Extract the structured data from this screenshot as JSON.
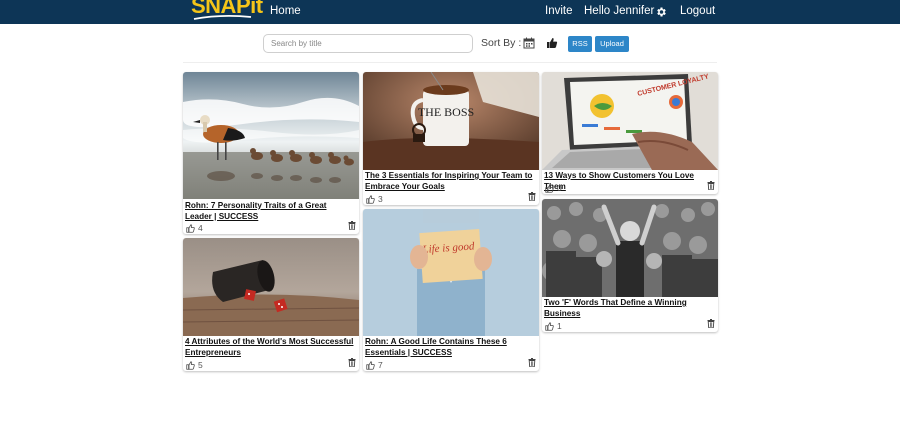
{
  "navbar": {
    "logo": "SNAPit",
    "home": "Home",
    "invite": "Invite",
    "greeting": "Hello Jennifer",
    "settings_icon": "gear-icon",
    "logout": "Logout",
    "background": "#0d3556",
    "logo_color": "#f5c518"
  },
  "toolbar": {
    "search_placeholder": "Search by title",
    "sort_label": "Sort By :",
    "sort_date_icon": "calendar-icon",
    "sort_likes_icon": "thumbs-up-icon",
    "rss_label": "RSS",
    "upload_label": "Upload",
    "button_color": "#2d86c8"
  },
  "cards": [
    {
      "title": "Rohn: 7 Personality Traits of a Great Leader | SUCCESS",
      "likes": "4",
      "image": "duck-and-ducklings-on-beach"
    },
    {
      "title": "The 3 Essentials for Inspiring Your Team to Embrace Your Goals",
      "likes": "3",
      "image": "the-boss-coffee-mug"
    },
    {
      "title": "13 Ways to Show Customers You Love Them",
      "likes": "0",
      "image": "laptop-customer-loyalty"
    },
    {
      "title": "4 Attributes of the World's Most Successful Entrepreneurs",
      "likes": "5",
      "image": "dice-cup-with-red-dice"
    },
    {
      "title": "Rohn: A Good Life Contains These 6 Essentials | SUCCESS",
      "likes": "7",
      "image": "hands-holding-life-is-good-note"
    },
    {
      "title": "Two 'F' Words That Define a Winning Business",
      "likes": "1",
      "image": "cheering-crowd-black-and-white"
    }
  ],
  "card_image_overlay": {
    "mug_text": "THE BOSS",
    "note_text": "Life is good",
    "screen_text": "CUSTOMER LOYALTY"
  }
}
